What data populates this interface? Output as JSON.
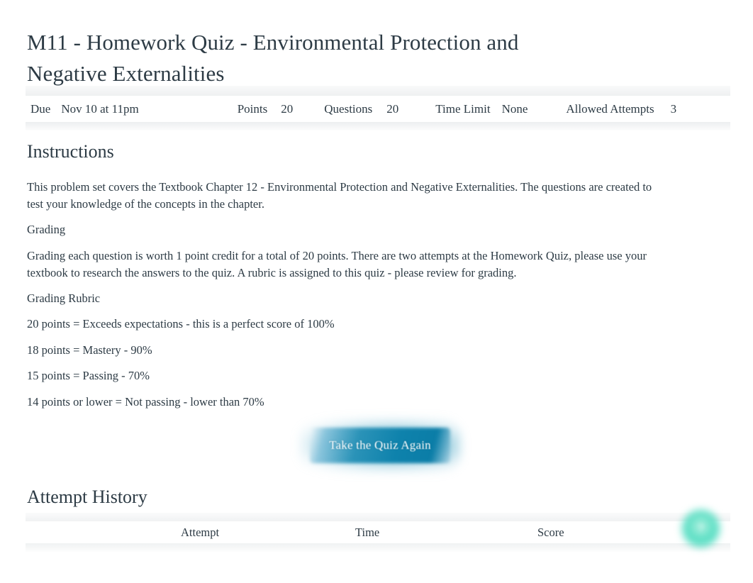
{
  "quiz": {
    "title": "M11 - Homework Quiz - Environmental Protection and Negative Externalities"
  },
  "meta": {
    "due_label": "Due",
    "due_value": "Nov 10 at 11pm",
    "points_label": "Points",
    "points_value": "20",
    "questions_label": "Questions",
    "questions_value": "20",
    "time_limit_label": "Time Limit",
    "time_limit_value": "None",
    "allowed_attempts_label": "Allowed Attempts",
    "allowed_attempts_value": "3"
  },
  "instructions": {
    "heading": "Instructions",
    "intro": "This problem set covers the Textbook Chapter 12 - Environmental Protection and Negative Externalities. The questions are created to test your knowledge of the concepts in the chapter.",
    "grading_label": "Grading",
    "grading_detail": "Grading each question is worth 1 point credit for a total of 20 points. There are two attempts at the Homework Quiz, please use your textbook to research the answers to the quiz. A rubric is assigned to this quiz - please review for grading.",
    "rubric_label": "Grading Rubric",
    "rubric_lines": [
      "20 points = Exceeds expectations - this is a perfect score of 100%",
      "18 points = Mastery - 90%",
      "15 points = Passing - 70%",
      "14 points or lower = Not passing - lower than 70%"
    ]
  },
  "actions": {
    "take_quiz_again": "Take the Quiz Again"
  },
  "attempt_history": {
    "heading": "Attempt History",
    "columns": [
      "Attempt",
      "Time",
      "Score"
    ],
    "rows": []
  },
  "help": {
    "icon": "help-bubble-icon",
    "glyph": "?"
  },
  "colors": {
    "text": "#2d3b45",
    "button_primary": "#0e82ac",
    "help_bubble": "#3cd8ba",
    "table_band": "#c7cdd1"
  }
}
